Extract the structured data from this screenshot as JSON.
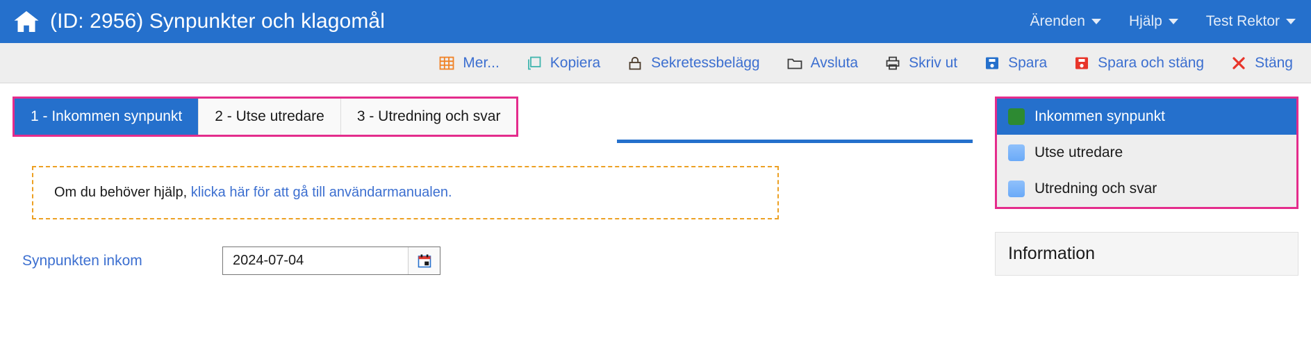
{
  "header": {
    "home_icon": "home-icon",
    "title": "(ID: 2956) Synpunkter och klagomål",
    "nav": [
      {
        "label": "Ärenden",
        "icon": "chevron-down-icon"
      },
      {
        "label": "Hjälp",
        "icon": "chevron-down-icon"
      },
      {
        "label": "Test Rektor",
        "icon": "chevron-down-icon"
      }
    ]
  },
  "toolbar": {
    "buttons": [
      {
        "label": "Mer...",
        "icon": "grid-icon",
        "color": "#f08226"
      },
      {
        "label": "Kopiera",
        "icon": "copy-icon",
        "color": "#3fb5ad"
      },
      {
        "label": "Sekretessbelägg",
        "icon": "lock-icon",
        "color": "#4a3a2a"
      },
      {
        "label": "Avsluta",
        "icon": "folder-icon",
        "color": "#3a3a3a"
      },
      {
        "label": "Skriv ut",
        "icon": "printer-icon",
        "color": "#3a3a3a"
      },
      {
        "label": "Spara",
        "icon": "floppy-icon",
        "color": "#2570cc"
      },
      {
        "label": "Spara och stäng",
        "icon": "floppy-red-icon",
        "color": "#e8352a"
      },
      {
        "label": "Stäng",
        "icon": "close-x-icon",
        "color": "#e8352a"
      }
    ]
  },
  "tabs": [
    {
      "label": "1 - Inkommen synpunkt",
      "active": true
    },
    {
      "label": "2 - Utse utredare",
      "active": false
    },
    {
      "label": "3 - Utredning och svar",
      "active": false
    }
  ],
  "notice": {
    "text": "Om du behöver hjälp, ",
    "link": "klicka här för att gå till användarmanualen."
  },
  "form": {
    "date_label": "Synpunkten inkom",
    "date_value": "2024-07-04",
    "calendar_icon": "calendar-icon"
  },
  "sidebar": {
    "status_items": [
      {
        "label": "Inkommen synpunkt",
        "swatch": "green",
        "active": true
      },
      {
        "label": "Utse utredare",
        "swatch": "blue",
        "active": false
      },
      {
        "label": "Utredning och svar",
        "swatch": "blue",
        "active": false
      }
    ],
    "info_title": "Information"
  },
  "colors": {
    "header_blue": "#2570cc",
    "accent_pink": "#e42c8c",
    "link_blue": "#3c6fd0",
    "notice_orange": "#eda022",
    "toolbar_bg": "#eeeeee"
  }
}
